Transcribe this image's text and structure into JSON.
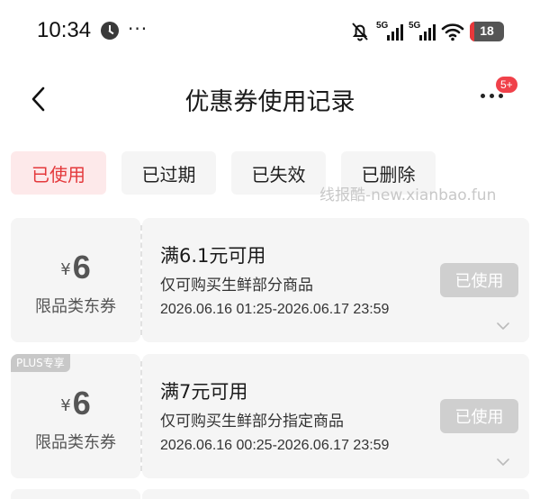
{
  "status_bar": {
    "time": "10:34",
    "extra": "···",
    "network_1": "5G",
    "network_2": "5G",
    "battery": "18"
  },
  "header": {
    "title": "优惠券使用记录",
    "badge": "5+"
  },
  "tabs": [
    {
      "label": "已使用",
      "active": true
    },
    {
      "label": "已过期",
      "active": false
    },
    {
      "label": "已失效",
      "active": false
    },
    {
      "label": "已删除",
      "active": false
    }
  ],
  "watermark": "线报酷-new.xianbao.fun",
  "coupons": [
    {
      "yen": "¥",
      "amount": "6",
      "type": "限品类东券",
      "condition": "满6.1元可用",
      "scope": "仅可购买生鲜部分商品",
      "validity": "2026.06.16 01:25-2026.06.17 23:59",
      "status": "已使用"
    },
    {
      "tag": "PLUS专享",
      "yen": "¥",
      "amount": "6",
      "type": "限品类东券",
      "condition": "满7元可用",
      "scope": "仅可购买生鲜部分指定商品",
      "validity": "2026.06.16 00:25-2026.06.17 23:59",
      "status": "已使用"
    }
  ],
  "colors": {
    "accent": "#e4393c",
    "active_tab_bg": "#fde9ea",
    "card_bg": "#f5f5f5",
    "disabled_button": "#cfcfcf",
    "badge": "#f0414a"
  }
}
